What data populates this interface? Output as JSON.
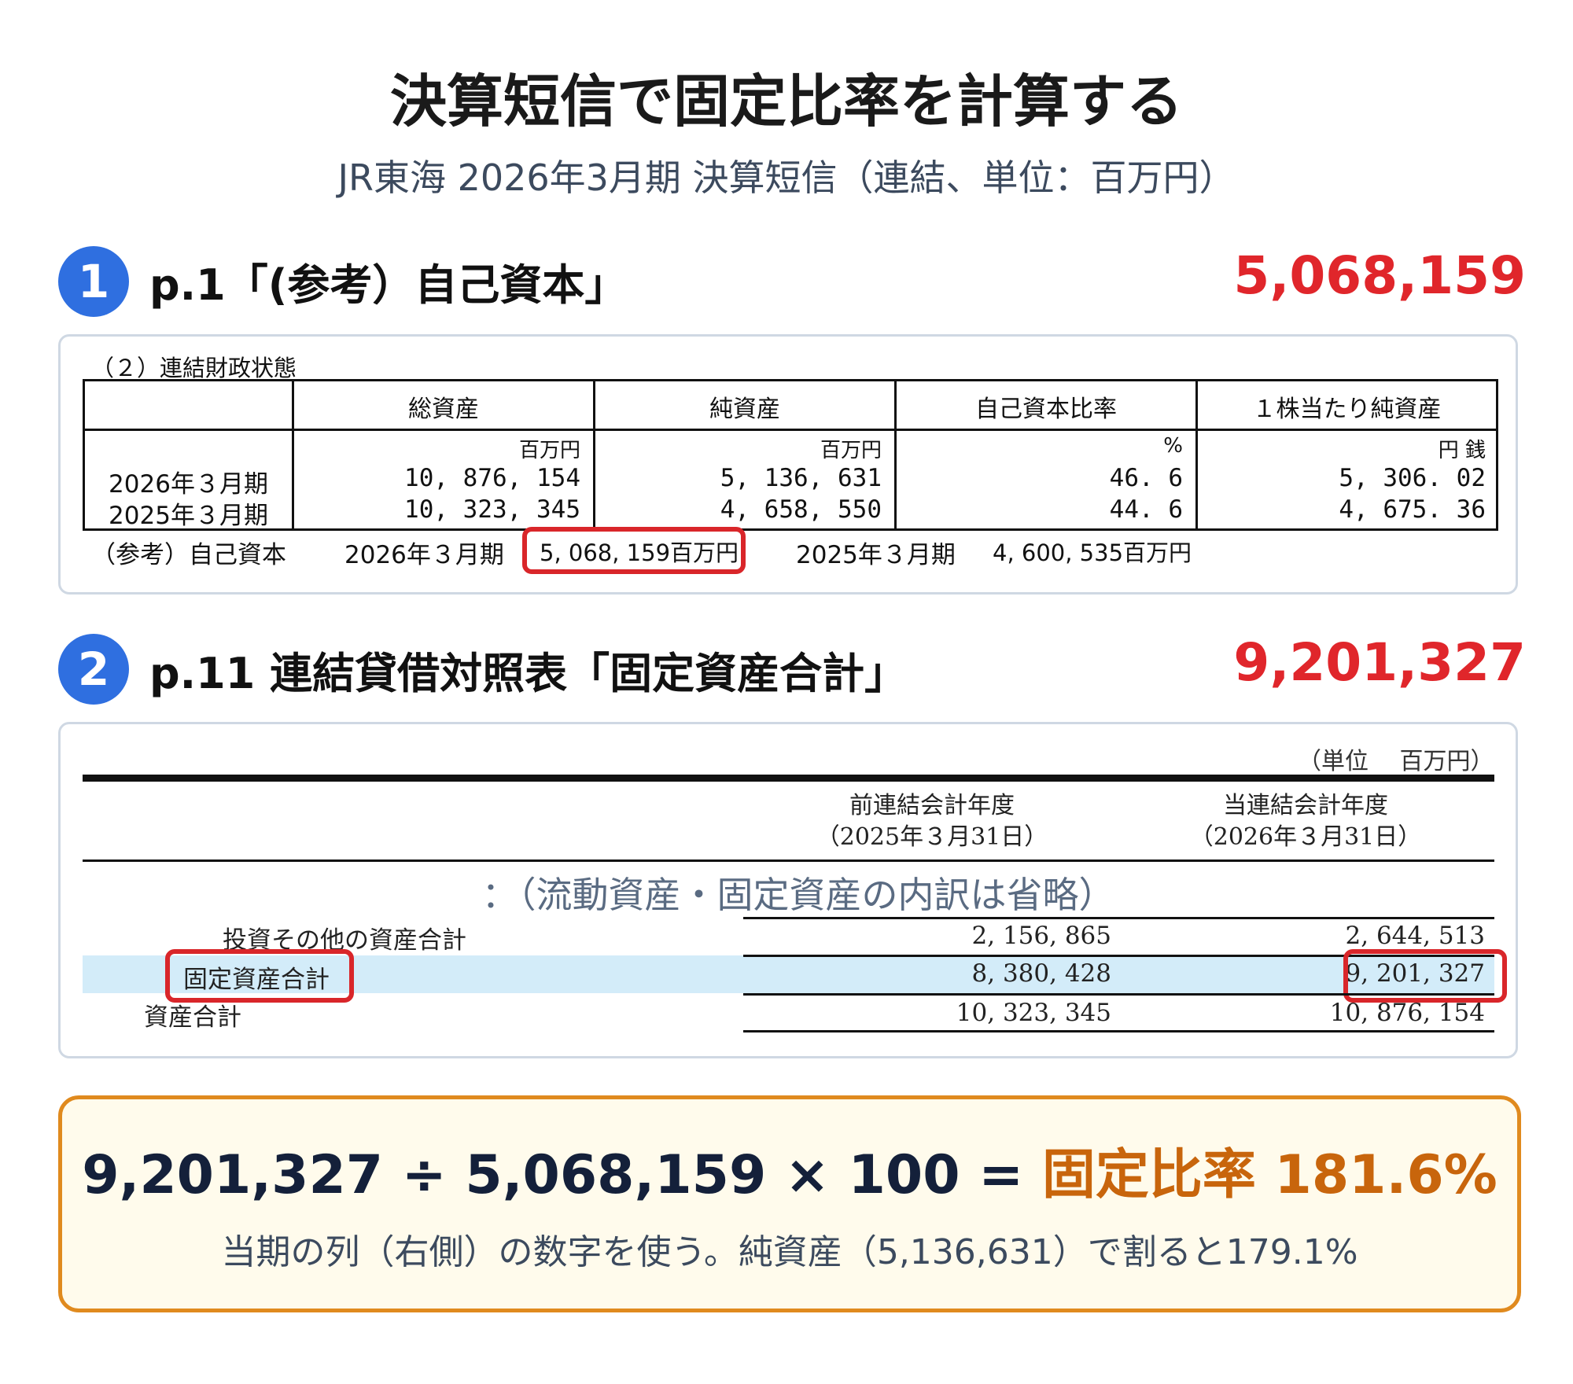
{
  "title": "決算短信で固定比率を計算する",
  "subtitle": "JR東海 2026年3月期 決算短信（連結、単位：百万円）",
  "step1": {
    "badge": "1",
    "heading": "p.1「(参考）自己資本」",
    "value": "5,068,159",
    "table": {
      "caption": "（２）連結財政状態",
      "headers": [
        "総資産",
        "純資産",
        "自己資本比率",
        "１株当たり純資産"
      ],
      "units": [
        "百万円",
        "百万円",
        "%",
        "円 銭"
      ],
      "rows": [
        {
          "label": "2026年３月期",
          "values": [
            "10, 876, 154",
            "5, 136, 631",
            "46. 6",
            "5, 306. 02"
          ]
        },
        {
          "label": "2025年３月期",
          "values": [
            "10, 323, 345",
            "4, 658, 550",
            "44. 6",
            "4, 675. 36"
          ]
        }
      ],
      "reference": {
        "label": "（参考）自己資本",
        "period1": "2026年３月期",
        "value1": "5, 068, 159百万円",
        "period2": "2025年３月期",
        "value2": "4, 600, 535百万円"
      }
    }
  },
  "step2": {
    "badge": "2",
    "heading": "p.11 連結貸借対照表「固定資産合計」",
    "value": "9,201,327",
    "table": {
      "unit": "（単位　 百万円）",
      "col_prev": [
        "前連結会計年度",
        "（2025年３月31日）"
      ],
      "col_curr": [
        "当連結会計年度",
        "（2026年３月31日）"
      ],
      "omitted": "：（流動資産・固定資産の内訳は省略）",
      "rows": [
        {
          "label": "投資その他の資産合計",
          "prev": "2, 156, 865",
          "curr": "2, 644, 513"
        },
        {
          "label": "固定資産合計",
          "prev": "8, 380, 428",
          "curr": "9, 201, 327"
        },
        {
          "label": "資産合計",
          "prev": "10, 323, 345",
          "curr": "10, 876, 154"
        }
      ]
    }
  },
  "formula": {
    "expression": "9,201,327 ÷ 5,068,159 × 100 = ",
    "result_label": "固定比率 181.6%",
    "note": "当期の列（右側）の数字を使う。純資産（5,136,631）で割ると179.1%"
  },
  "colors": {
    "accent_red": "#e0262b",
    "badge_blue": "#2f6fe0",
    "result_orange": "#c8650c",
    "highlight_blue": "#d3ecf9",
    "box_border_orange": "#e08a1e"
  }
}
